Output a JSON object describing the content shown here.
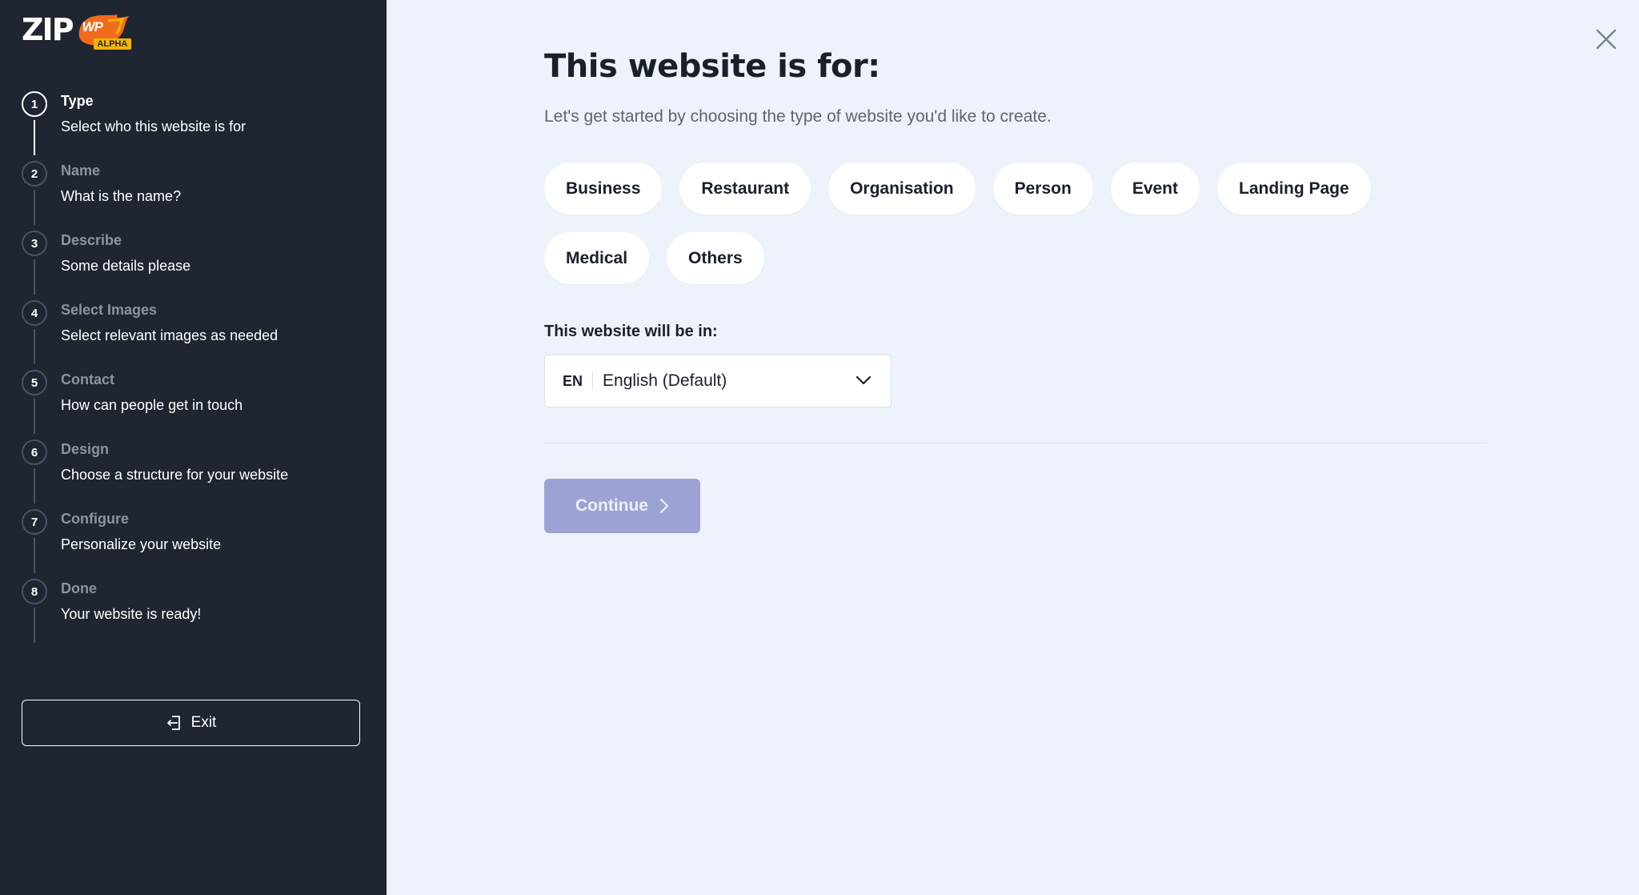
{
  "brand": {
    "logo_text": "ZIP",
    "badge_text": "WP",
    "alpha_label": "ALPHA"
  },
  "steps": [
    {
      "number": "1",
      "title": "Type",
      "description": "Select who this website is for",
      "active": true
    },
    {
      "number": "2",
      "title": "Name",
      "description": "What is the name?",
      "active": false
    },
    {
      "number": "3",
      "title": "Describe",
      "description": "Some details please",
      "active": false
    },
    {
      "number": "4",
      "title": "Select Images",
      "description": "Select relevant images as needed",
      "active": false
    },
    {
      "number": "5",
      "title": "Contact",
      "description": "How can people get in touch",
      "active": false
    },
    {
      "number": "6",
      "title": "Design",
      "description": "Choose a structure for your website",
      "active": false
    },
    {
      "number": "7",
      "title": "Configure",
      "description": "Personalize your website",
      "active": false
    },
    {
      "number": "8",
      "title": "Done",
      "description": "Your website is ready!",
      "active": false
    }
  ],
  "exit_label": "Exit",
  "main": {
    "title": "This website is for:",
    "subtitle": "Let's get started by choosing the type of website you'd like to create.",
    "types": [
      "Business",
      "Restaurant",
      "Organisation",
      "Person",
      "Event",
      "Landing Page",
      "Medical",
      "Others"
    ],
    "language_label": "This website will be in:",
    "language_code": "EN",
    "language_selected": "English (Default)",
    "continue_label": "Continue"
  },
  "colors": {
    "sidebar_bg": "#1f2531",
    "main_bg": "#eef2fa",
    "accent_orange": "#f26b1d",
    "badge_yellow": "#f7b500",
    "continue_disabled": "#9ca3d4"
  },
  "icons": {
    "exit": "exit-door-icon",
    "close": "close-icon",
    "chevron_down": "chevron-down-icon",
    "chevron_right": "chevron-right-icon"
  }
}
